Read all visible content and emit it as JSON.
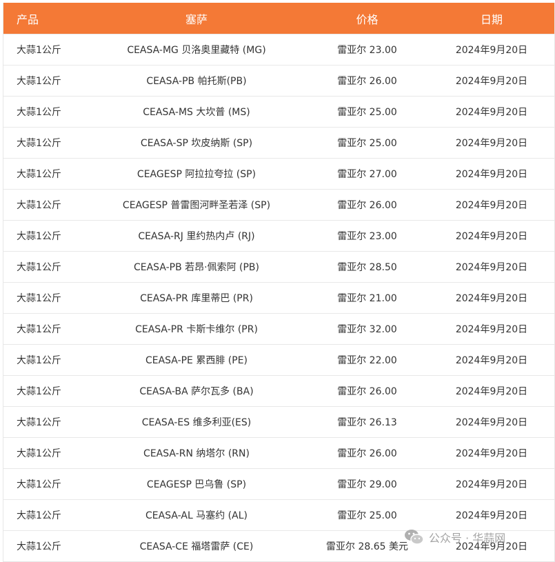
{
  "table": {
    "headers": [
      "产品",
      "塞萨",
      "价格",
      "日期"
    ],
    "rows": [
      [
        "大蒜1公斤",
        "CEASA-MG 贝洛奥里藏特 (MG)",
        "雷亚尔 23.00",
        "2024年9月20日"
      ],
      [
        "大蒜1公斤",
        "CEASA-PB 帕托斯(PB)",
        "雷亚尔 26.00",
        "2024年9月20日"
      ],
      [
        "大蒜1公斤",
        "CEASA-MS 大坎普 (MS)",
        "雷亚尔 25.00",
        "2024年9月20日"
      ],
      [
        "大蒜1公斤",
        "CEASA-SP 坎皮纳斯 (SP)",
        "雷亚尔 25.00",
        "2024年9月20日"
      ],
      [
        "大蒜1公斤",
        "CEAGESP 阿拉拉夸拉 (SP)",
        "雷亚尔 27.00",
        "2024年9月20日"
      ],
      [
        "大蒜1公斤",
        "CEAGESP 普雷图河畔圣若泽 (SP)",
        "雷亚尔 26.00",
        "2024年9月20日"
      ],
      [
        "大蒜1公斤",
        "CEASA-RJ 里约热内卢 (RJ)",
        "雷亚尔 23.00",
        "2024年9月20日"
      ],
      [
        "大蒜1公斤",
        "CEASA-PB 若昂·佩索阿 (PB)",
        "雷亚尔 28.50",
        "2024年9月20日"
      ],
      [
        "大蒜1公斤",
        "CEASA-PR 库里蒂巴 (PR)",
        "雷亚尔 21.00",
        "2024年9月20日"
      ],
      [
        "大蒜1公斤",
        "CEASA-PR 卡斯卡维尔 (PR)",
        "雷亚尔 32.00",
        "2024年9月20日"
      ],
      [
        "大蒜1公斤",
        "CEASA-PE 累西腓 (PE)",
        "雷亚尔 22.00",
        "2024年9月20日"
      ],
      [
        "大蒜1公斤",
        "CEASA-BA 萨尔瓦多 (BA)",
        "雷亚尔 26.00",
        "2024年9月20日"
      ],
      [
        "大蒜1公斤",
        "CEASA-ES 维多利亚(ES)",
        "雷亚尔 26.13",
        "2024年9月20日"
      ],
      [
        "大蒜1公斤",
        "CEASA-RN 纳塔尔 (RN)",
        "雷亚尔 26.00",
        "2024年9月20日"
      ],
      [
        "大蒜1公斤",
        "CEAGESP 巴乌鲁 (SP)",
        "雷亚尔 29.00",
        "2024年9月20日"
      ],
      [
        "大蒜1公斤",
        "CEASA-AL 马塞约 (AL)",
        "雷亚尔 25.00",
        "2024年9月20日"
      ],
      [
        "大蒜1公斤",
        "CEASA-CE 福塔雷萨 (CE)",
        "雷亚尔 28.65 美元",
        "2024年9月20日"
      ]
    ]
  },
  "watermark": {
    "icon": "wechat-icon",
    "text": "公众号 · 华蒜网"
  },
  "colors": {
    "header_bg": "#f47936",
    "header_text": "#ffffff",
    "row_border": "#e8e8e8",
    "body_text": "#333333"
  }
}
